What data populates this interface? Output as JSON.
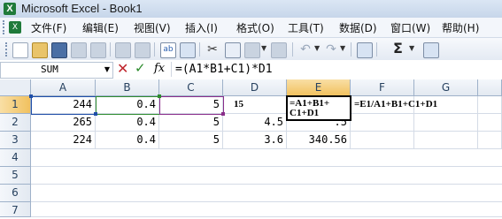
{
  "window": {
    "title": "Microsoft Excel - Book1"
  },
  "menu": {
    "items": [
      "文件(F)",
      "编辑(E)",
      "视图(V)",
      "插入(I)",
      "格式(O)",
      "工具(T)",
      "数据(D)",
      "窗口(W)",
      "帮助(H)"
    ]
  },
  "toolbar": {
    "icons": [
      "new-icon",
      "open-icon",
      "save-icon",
      "permission-icon",
      "email-icon",
      "print-icon",
      "print-preview-icon",
      "spelling-icon",
      "research-icon",
      "cut-icon",
      "copy-icon",
      "paste-icon",
      "format-painter-icon",
      "undo-icon",
      "redo-icon",
      "hyperlink-icon",
      "autosum-icon",
      "sort-icon"
    ],
    "autosum_label": "Σ"
  },
  "formula_bar": {
    "name_box": "SUM",
    "cancel_icon": "✕",
    "enter_icon": "✓",
    "fx_label": "fx",
    "formula": "=(A1*B1+C1)*D1"
  },
  "grid": {
    "columns": [
      "A",
      "B",
      "C",
      "D",
      "E",
      "F",
      "G"
    ],
    "rows": [
      "1",
      "2",
      "3",
      "4",
      "5",
      "6",
      "7"
    ],
    "cells": {
      "A1": "244",
      "B1": "0.4",
      "C1": "5",
      "D1": "15",
      "E1_line1": "=A1+B1+",
      "E1_line2": "C1+D1",
      "F1": "=E1/A1+B1+C1+D1",
      "A2": "265",
      "B2": "0.4",
      "C2": "5",
      "D2": "4.5",
      "E2": ".5",
      "A3": "224",
      "B3": "0.4",
      "C3": "5",
      "D3": "3.6",
      "E3": "340.56"
    },
    "selected_column": "E",
    "selected_row": "1"
  }
}
